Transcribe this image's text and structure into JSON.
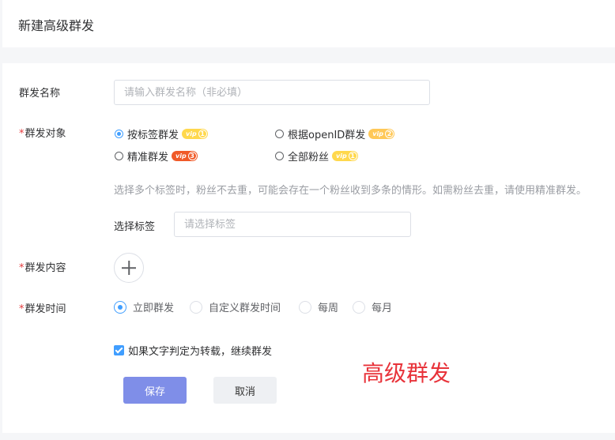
{
  "page": {
    "title": "新建高级群发"
  },
  "form": {
    "name": {
      "label": "群发名称",
      "placeholder": "请输入群发名称（非必填）",
      "value": ""
    },
    "target": {
      "required_mark": "*",
      "label": "群发对象",
      "options": [
        {
          "label": "按标签群发",
          "badge": "vip",
          "level": "1",
          "badge_color": "#ffd84d",
          "selected": true
        },
        {
          "label": "根据openID群发",
          "badge": "vip",
          "level": "2",
          "badge_color": "#ffc857",
          "selected": false
        },
        {
          "label": "精准群发",
          "badge": "vip",
          "level": "3",
          "badge_color": "#f05a28",
          "selected": false
        },
        {
          "label": "全部粉丝",
          "badge": "vip",
          "level": "1",
          "badge_color": "#ffd84d",
          "selected": false
        }
      ],
      "hint": "选择多个标签时，粉丝不去重，可能会存在一个粉丝收到多条的情形。如需粉丝去重，请使用精准群发。"
    },
    "tag": {
      "label": "选择标签",
      "placeholder": "请选择标签",
      "value": ""
    },
    "content": {
      "required_mark": "*",
      "label": "群发内容",
      "add_icon": "plus-icon"
    },
    "time": {
      "required_mark": "*",
      "label": "群发时间",
      "options": [
        {
          "label": "立即群发",
          "selected": true
        },
        {
          "label": "自定义群发时间",
          "selected": false
        },
        {
          "label": "每周",
          "selected": false
        },
        {
          "label": "每月",
          "selected": false
        }
      ]
    },
    "repost": {
      "label": "如果文字判定为转载，继续群发",
      "checked": true
    },
    "buttons": {
      "save": "保存",
      "cancel": "取消"
    }
  },
  "overlay_text": "高级群发",
  "colors": {
    "accent": "#409eff",
    "primary_button": "#7f8ee8",
    "required": "#e4393c",
    "overlay": "#e8333a"
  }
}
